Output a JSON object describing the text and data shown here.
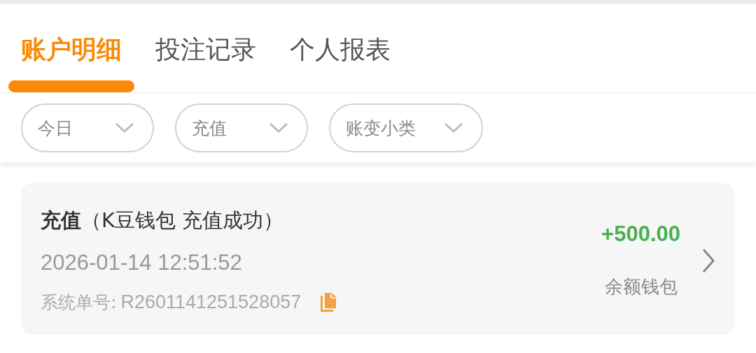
{
  "tabs": [
    {
      "label": "账户明细",
      "selected": true
    },
    {
      "label": "投注记录",
      "selected": false
    },
    {
      "label": "个人报表",
      "selected": false
    }
  ],
  "filters": [
    {
      "label": "今日"
    },
    {
      "label": "充值"
    },
    {
      "label": "账变小类"
    }
  ],
  "records": [
    {
      "title": "**充值**（K豆钱包 充值成功）",
      "time": "2026-01-14 12:51:52",
      "order_label": "系统单号:",
      "order_no": "R2601141251528057",
      "amount": "+500.00",
      "wallet": "余额钱包"
    }
  ]
}
